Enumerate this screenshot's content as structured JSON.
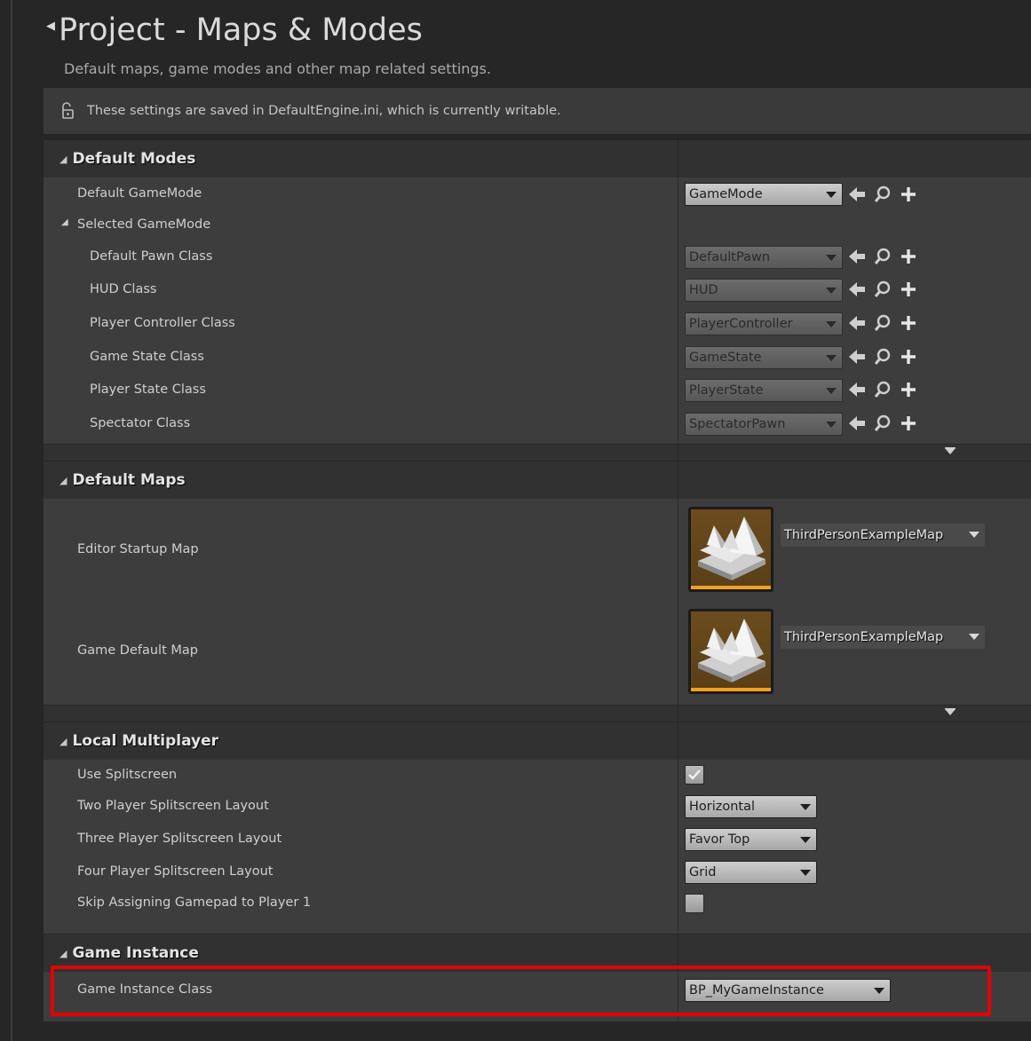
{
  "page": {
    "title": "Project - Maps & Modes",
    "subtitle": "Default maps, game modes and other map related settings.",
    "notice": "These settings are saved in DefaultEngine.ini, which is currently writable."
  },
  "default_modes": {
    "header": "Default Modes",
    "default_gamemode_label": "Default GameMode",
    "default_gamemode_value": "GameMode",
    "selected_gamemode_label": "Selected GameMode",
    "rows": [
      {
        "label": "Default Pawn Class",
        "value": "DefaultPawn"
      },
      {
        "label": "HUD Class",
        "value": "HUD"
      },
      {
        "label": "Player Controller Class",
        "value": "PlayerController"
      },
      {
        "label": "Game State Class",
        "value": "GameState"
      },
      {
        "label": "Player State Class",
        "value": "PlayerState"
      },
      {
        "label": "Spectator Class",
        "value": "SpectatorPawn"
      }
    ]
  },
  "default_maps": {
    "header": "Default Maps",
    "editor_startup_label": "Editor Startup Map",
    "editor_startup_value": "ThirdPersonExampleMap",
    "game_default_label": "Game Default Map",
    "game_default_value": "ThirdPersonExampleMap"
  },
  "local_multiplayer": {
    "header": "Local Multiplayer",
    "use_splitscreen_label": "Use Splitscreen",
    "use_splitscreen_checked": true,
    "two_player_label": "Two Player Splitscreen Layout",
    "two_player_value": "Horizontal",
    "three_player_label": "Three Player Splitscreen Layout",
    "three_player_value": "Favor Top",
    "four_player_label": "Four Player Splitscreen Layout",
    "four_player_value": "Grid",
    "skip_gamepad_label": "Skip Assigning Gamepad to Player 1",
    "skip_gamepad_checked": false
  },
  "game_instance": {
    "header": "Game Instance",
    "class_label": "Game Instance Class",
    "class_value": "BP_MyGameInstance"
  },
  "icons": [
    "lock-open-icon",
    "browse-back-arrow-icon",
    "search-icon",
    "add-plus-icon",
    "collapse-triangle-icon",
    "expand-arrow-icon",
    "checkmark-icon"
  ],
  "colors": {
    "highlight": "#e40000",
    "thumbnail_bar": "#f0a020",
    "panel": "#3d3d3d",
    "header": "#313131"
  }
}
